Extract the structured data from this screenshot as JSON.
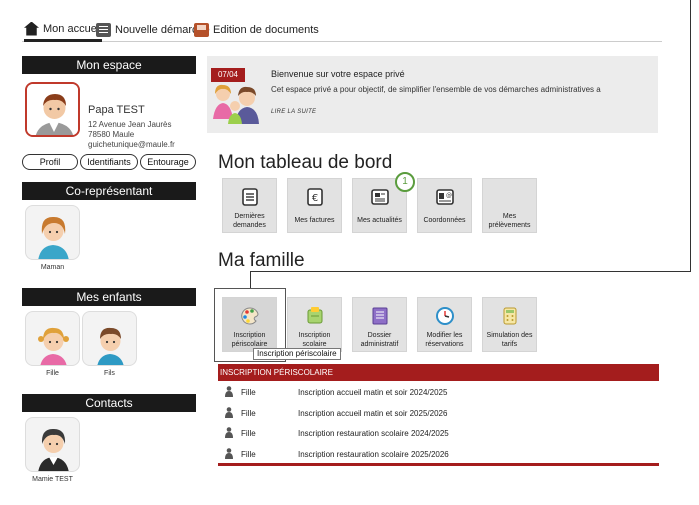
{
  "nav": {
    "tabs": [
      {
        "label": "Mon accueil",
        "icon": "home-icon",
        "active": true
      },
      {
        "label": "Nouvelle démarche",
        "icon": "document-icon",
        "active": false
      },
      {
        "label": "Edition de documents",
        "icon": "print-icon",
        "active": false
      }
    ]
  },
  "sidebar": {
    "mon_espace": {
      "title": "Mon espace",
      "name": "Papa TEST",
      "address_line1": "12 Avenue Jean Jaurès",
      "address_line2": "78580 Maule",
      "email": "guichetunique@maule.fr",
      "buttons": [
        "Profil",
        "Identifiants",
        "Entourage"
      ]
    },
    "corepresentant": {
      "title": "Co-représentant",
      "people": [
        {
          "label": "Maman"
        }
      ]
    },
    "enfants": {
      "title": "Mes enfants",
      "people": [
        {
          "label": "Fille"
        },
        {
          "label": "Fils"
        }
      ]
    },
    "contacts": {
      "title": "Contacts",
      "people": [
        {
          "label": "Mamie TEST"
        }
      ]
    }
  },
  "welcome": {
    "date": "07/04",
    "title": "Bienvenue sur votre espace privé",
    "text": "Cet espace privé a pour objectif, de simplifier l'ensemble de vos démarches administratives a",
    "more": "LIRE LA SUITE"
  },
  "board": {
    "title": "Mon tableau de bord",
    "step": "1",
    "tiles": [
      {
        "label": "Dernières demandes",
        "icon": "documents-icon"
      },
      {
        "label": "Mes factures",
        "icon": "invoice-euro-icon"
      },
      {
        "label": "Mes actualités",
        "icon": "news-icon"
      },
      {
        "label": "Coordonnées",
        "icon": "contact-card-icon"
      },
      {
        "label": "Mes prélèvements",
        "icon": "direct-debit-icon"
      }
    ]
  },
  "family": {
    "title": "Ma famille",
    "tooltip": "Inscription périscolaire",
    "tiles": [
      {
        "label": "Inscription périscolaire",
        "icon": "palette-icon"
      },
      {
        "label": "Inscription scolaire",
        "icon": "school-icon"
      },
      {
        "label": "Dossier administratif",
        "icon": "folder-icon"
      },
      {
        "label": "Modifier les réservations",
        "icon": "clock-icon"
      },
      {
        "label": "Simulation des tarifs",
        "icon": "calculator-icon"
      }
    ]
  },
  "table": {
    "header": "INSCRIPTION PÉRISCOLAIRE",
    "rows": [
      {
        "who": "Fille",
        "what": "Inscription accueil matin et soir 2024/2025"
      },
      {
        "who": "Fille",
        "what": "Inscription accueil matin et soir 2025/2026"
      },
      {
        "who": "Fille",
        "what": "Inscription restauration scolaire 2024/2025"
      },
      {
        "who": "Fille",
        "what": "Inscription restauration scolaire 2025/2026"
      }
    ]
  },
  "colors": {
    "accent_red": "#a41d1d",
    "badge_green": "#5a9c3d",
    "sidebar_header": "#1a1a1a"
  }
}
